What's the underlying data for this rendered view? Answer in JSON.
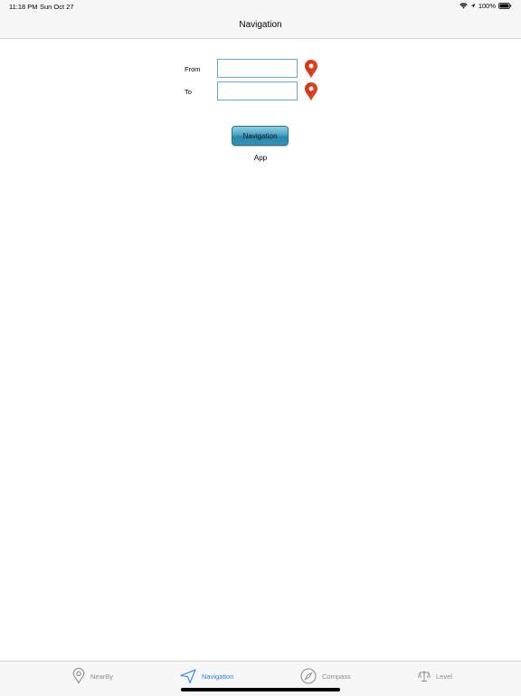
{
  "status": {
    "time": "11:18 PM",
    "date": "Sun Oct 27",
    "battery": "100%"
  },
  "nav": {
    "title": "Navigation"
  },
  "form": {
    "from_label": "From",
    "to_label": "To",
    "from_value": "",
    "to_value": ""
  },
  "button": {
    "label": "Navigation"
  },
  "app_label": "App",
  "tabs": [
    {
      "label": "NearBy",
      "icon": "location-pin-icon"
    },
    {
      "label": "Navigation",
      "icon": "navigation-arrow-icon"
    },
    {
      "label": "Compass",
      "icon": "compass-icon"
    },
    {
      "label": "Level",
      "icon": "scale-icon"
    }
  ],
  "colors": {
    "accent": "#2f80ed",
    "pin": "#e0401c",
    "field_border": "#64a8e6",
    "button": "#3a9bbd"
  }
}
